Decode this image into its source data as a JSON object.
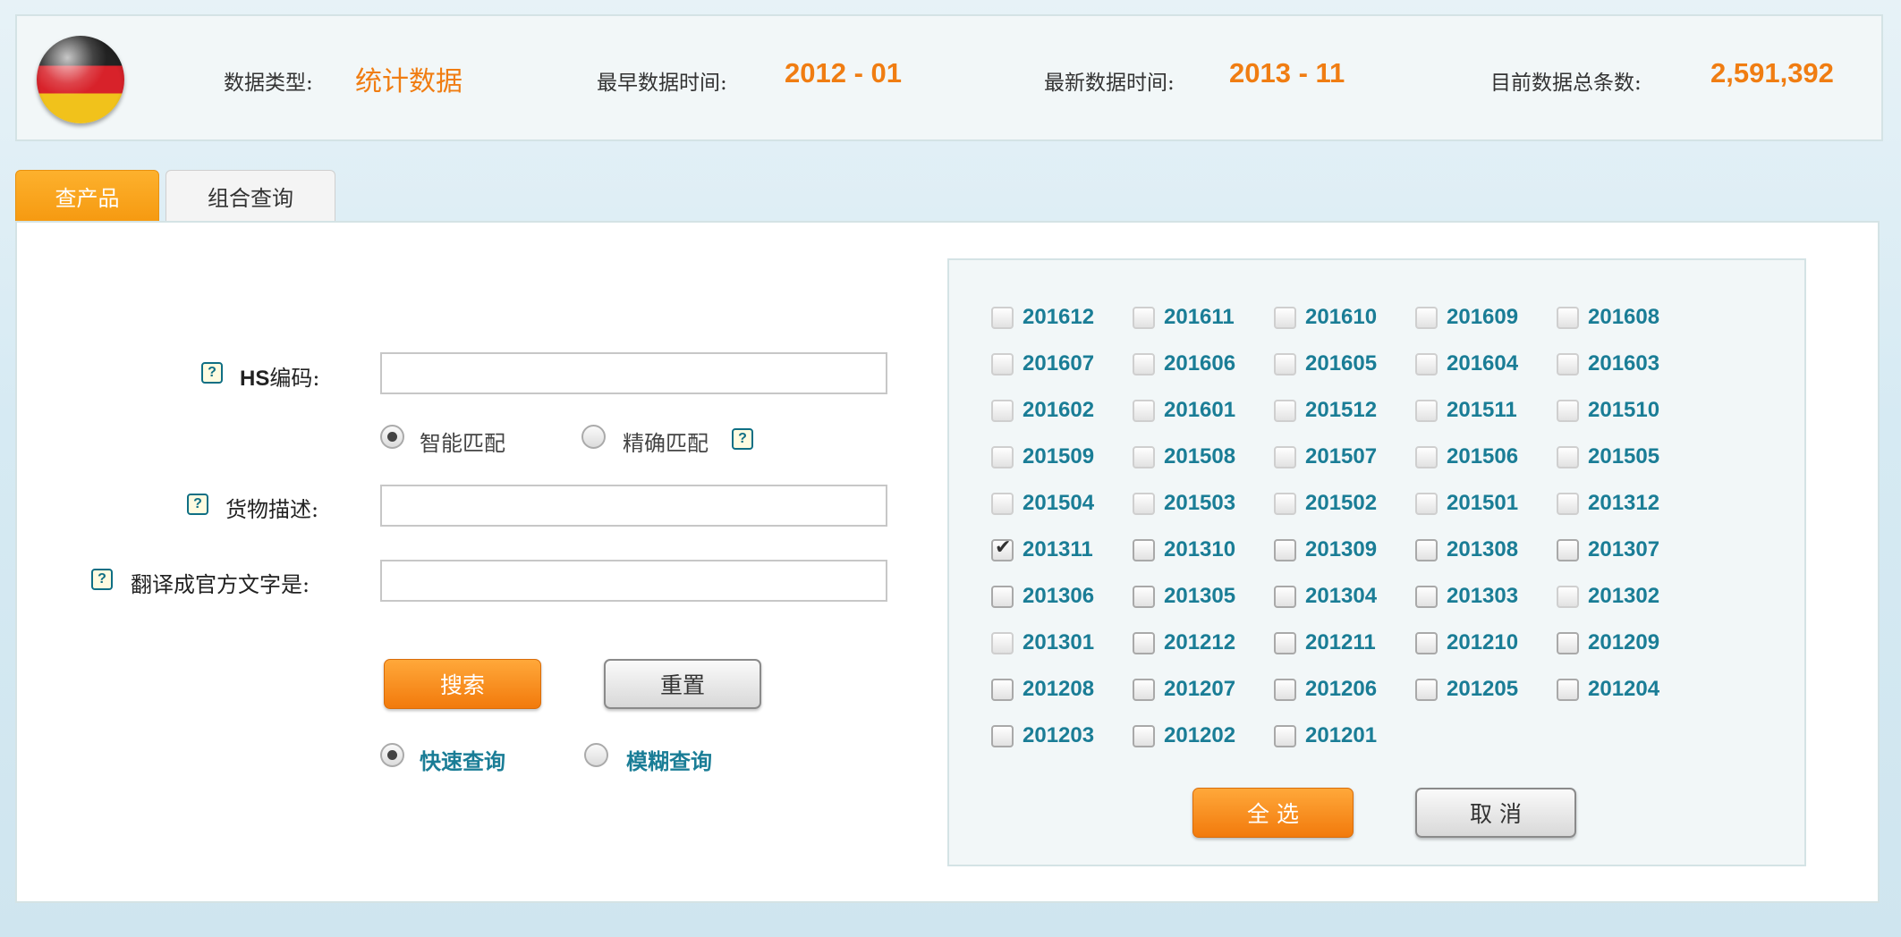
{
  "header": {
    "data_type_label": "数据类型:",
    "data_type_value": "统计数据",
    "earliest_label": "最早数据时间:",
    "earliest_value": "2012 - 01",
    "latest_label": "最新数据时间:",
    "latest_value": "2013 - 11",
    "total_label": "目前数据总条数:",
    "total_value": "2,591,392",
    "flag_icon": "germany-flag-icon"
  },
  "tabs": [
    {
      "label": "查产品",
      "active": true
    },
    {
      "label": "组合查询",
      "active": false
    }
  ],
  "form": {
    "hs_prefix": "HS",
    "hs_suffix": "编码:",
    "hs_value": "",
    "match_options": [
      "智能匹配",
      "精确匹配"
    ],
    "match_selected": "智能匹配",
    "desc_label": "货物描述:",
    "desc_value": "",
    "translate_label": "翻译成官方文字是:",
    "translate_value": "",
    "search_button": "搜索",
    "reset_button": "重置",
    "query_options": [
      "快速查询",
      "模糊查询"
    ],
    "query_selected": "快速查询",
    "help_glyph": "?"
  },
  "months": [
    {
      "label": "201612",
      "checked": false,
      "faint": true
    },
    {
      "label": "201611",
      "checked": false,
      "faint": true
    },
    {
      "label": "201610",
      "checked": false,
      "faint": true
    },
    {
      "label": "201609",
      "checked": false,
      "faint": true
    },
    {
      "label": "201608",
      "checked": false,
      "faint": true
    },
    {
      "label": "201607",
      "checked": false,
      "faint": true
    },
    {
      "label": "201606",
      "checked": false,
      "faint": true
    },
    {
      "label": "201605",
      "checked": false,
      "faint": true
    },
    {
      "label": "201604",
      "checked": false,
      "faint": true
    },
    {
      "label": "201603",
      "checked": false,
      "faint": true
    },
    {
      "label": "201602",
      "checked": false,
      "faint": true
    },
    {
      "label": "201601",
      "checked": false,
      "faint": true
    },
    {
      "label": "201512",
      "checked": false,
      "faint": true
    },
    {
      "label": "201511",
      "checked": false,
      "faint": true
    },
    {
      "label": "201510",
      "checked": false,
      "faint": true
    },
    {
      "label": "201509",
      "checked": false,
      "faint": true
    },
    {
      "label": "201508",
      "checked": false,
      "faint": true
    },
    {
      "label": "201507",
      "checked": false,
      "faint": true
    },
    {
      "label": "201506",
      "checked": false,
      "faint": true
    },
    {
      "label": "201505",
      "checked": false,
      "faint": true
    },
    {
      "label": "201504",
      "checked": false,
      "faint": true
    },
    {
      "label": "201503",
      "checked": false,
      "faint": true
    },
    {
      "label": "201502",
      "checked": false,
      "faint": true
    },
    {
      "label": "201501",
      "checked": false,
      "faint": true
    },
    {
      "label": "201312",
      "checked": false,
      "faint": true
    },
    {
      "label": "201311",
      "checked": true,
      "faint": false
    },
    {
      "label": "201310",
      "checked": false,
      "faint": false
    },
    {
      "label": "201309",
      "checked": false,
      "faint": false
    },
    {
      "label": "201308",
      "checked": false,
      "faint": false
    },
    {
      "label": "201307",
      "checked": false,
      "faint": false
    },
    {
      "label": "201306",
      "checked": false,
      "faint": false
    },
    {
      "label": "201305",
      "checked": false,
      "faint": false
    },
    {
      "label": "201304",
      "checked": false,
      "faint": false
    },
    {
      "label": "201303",
      "checked": false,
      "faint": false
    },
    {
      "label": "201302",
      "checked": false,
      "faint": true
    },
    {
      "label": "201301",
      "checked": false,
      "faint": true
    },
    {
      "label": "201212",
      "checked": false,
      "faint": false
    },
    {
      "label": "201211",
      "checked": false,
      "faint": false
    },
    {
      "label": "201210",
      "checked": false,
      "faint": false
    },
    {
      "label": "201209",
      "checked": false,
      "faint": false
    },
    {
      "label": "201208",
      "checked": false,
      "faint": false
    },
    {
      "label": "201207",
      "checked": false,
      "faint": false
    },
    {
      "label": "201206",
      "checked": false,
      "faint": false
    },
    {
      "label": "201205",
      "checked": false,
      "faint": false
    },
    {
      "label": "201204",
      "checked": false,
      "faint": false
    },
    {
      "label": "201203",
      "checked": false,
      "faint": false
    },
    {
      "label": "201202",
      "checked": false,
      "faint": false
    },
    {
      "label": "201201",
      "checked": false,
      "faint": false
    }
  ],
  "month_buttons": {
    "select_all": "全 选",
    "cancel": "取 消"
  },
  "colors": {
    "accent_orange": "#f07d12",
    "link_teal": "#1a7d96"
  }
}
